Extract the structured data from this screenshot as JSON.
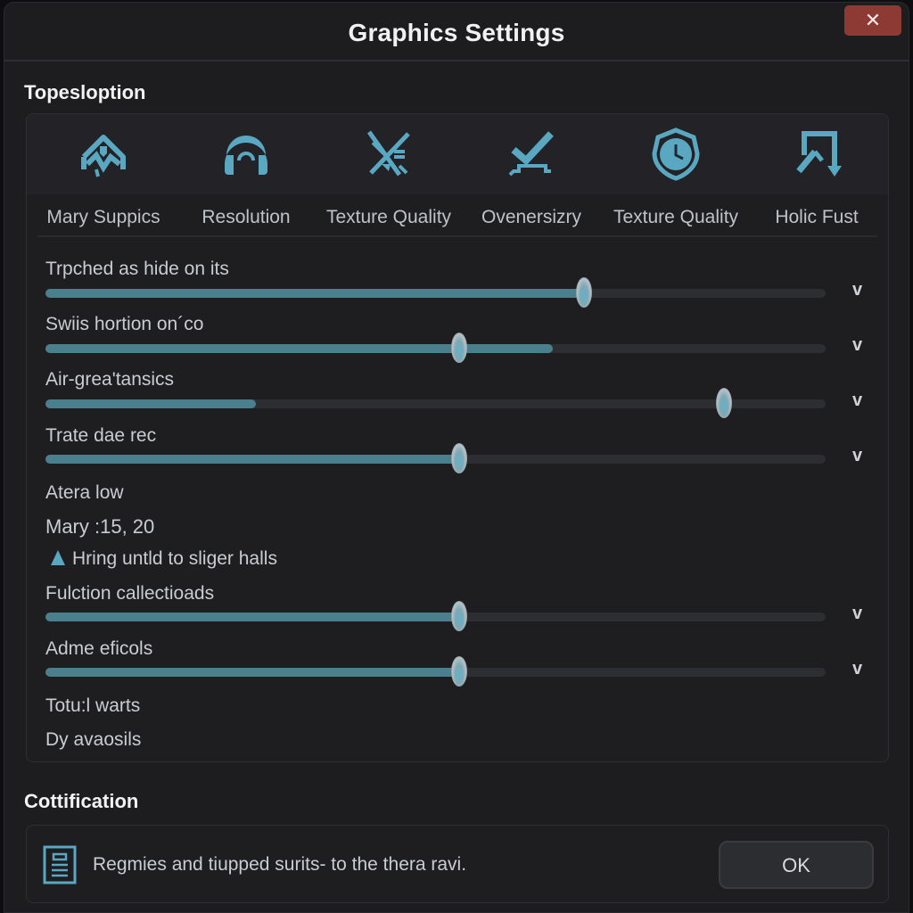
{
  "window": {
    "title": "Graphics Settings",
    "close_label": "✕"
  },
  "sections": {
    "options_heading": "Topesloption",
    "notification_heading": "Cottification"
  },
  "tabs": [
    {
      "label": "Mary Suppics",
      "icon": "house-chart-icon"
    },
    {
      "label": "Resolution",
      "icon": "headset-icon"
    },
    {
      "label": "Texture Quality",
      "icon": "texture-off-icon"
    },
    {
      "label": "Ovenersizry",
      "icon": "check-platform-icon"
    },
    {
      "label": "Texture Quality",
      "icon": "shield-clock-icon"
    },
    {
      "label": "Holic Fust",
      "icon": "arrow-down-frame-icon"
    }
  ],
  "sliders": [
    {
      "label": "Trpched as hide on its",
      "value": 0.69,
      "fill": 0.69
    },
    {
      "label": "Swiis hortion on´co",
      "value": 0.53,
      "fill": 0.65
    },
    {
      "label": "Air-grea'tansics",
      "value": 0.87,
      "fill": 0.27
    },
    {
      "label": "Trate dae rec",
      "value": 0.53,
      "fill": 0.53
    }
  ],
  "info": {
    "line1": "Atera low",
    "line2": "Mary :15, 20",
    "warning": "Hring untld to sliger halls"
  },
  "sliders2": [
    {
      "label": "Fulction callectioads",
      "value": 0.53,
      "fill": 0.53
    },
    {
      "label": "Adme eficols",
      "value": 0.53,
      "fill": 0.53
    }
  ],
  "footer_lines": [
    "Totu:l warts",
    "Dy avaosils"
  ],
  "dropdown_glyph": "v",
  "notification": {
    "message": "Regmies and tiupped surits- to the thera ravi.",
    "ok_label": "OK"
  },
  "colors": {
    "accent": "#5aa7c2",
    "slider_fill": "#4a7f8e",
    "close": "#8e3a34"
  }
}
